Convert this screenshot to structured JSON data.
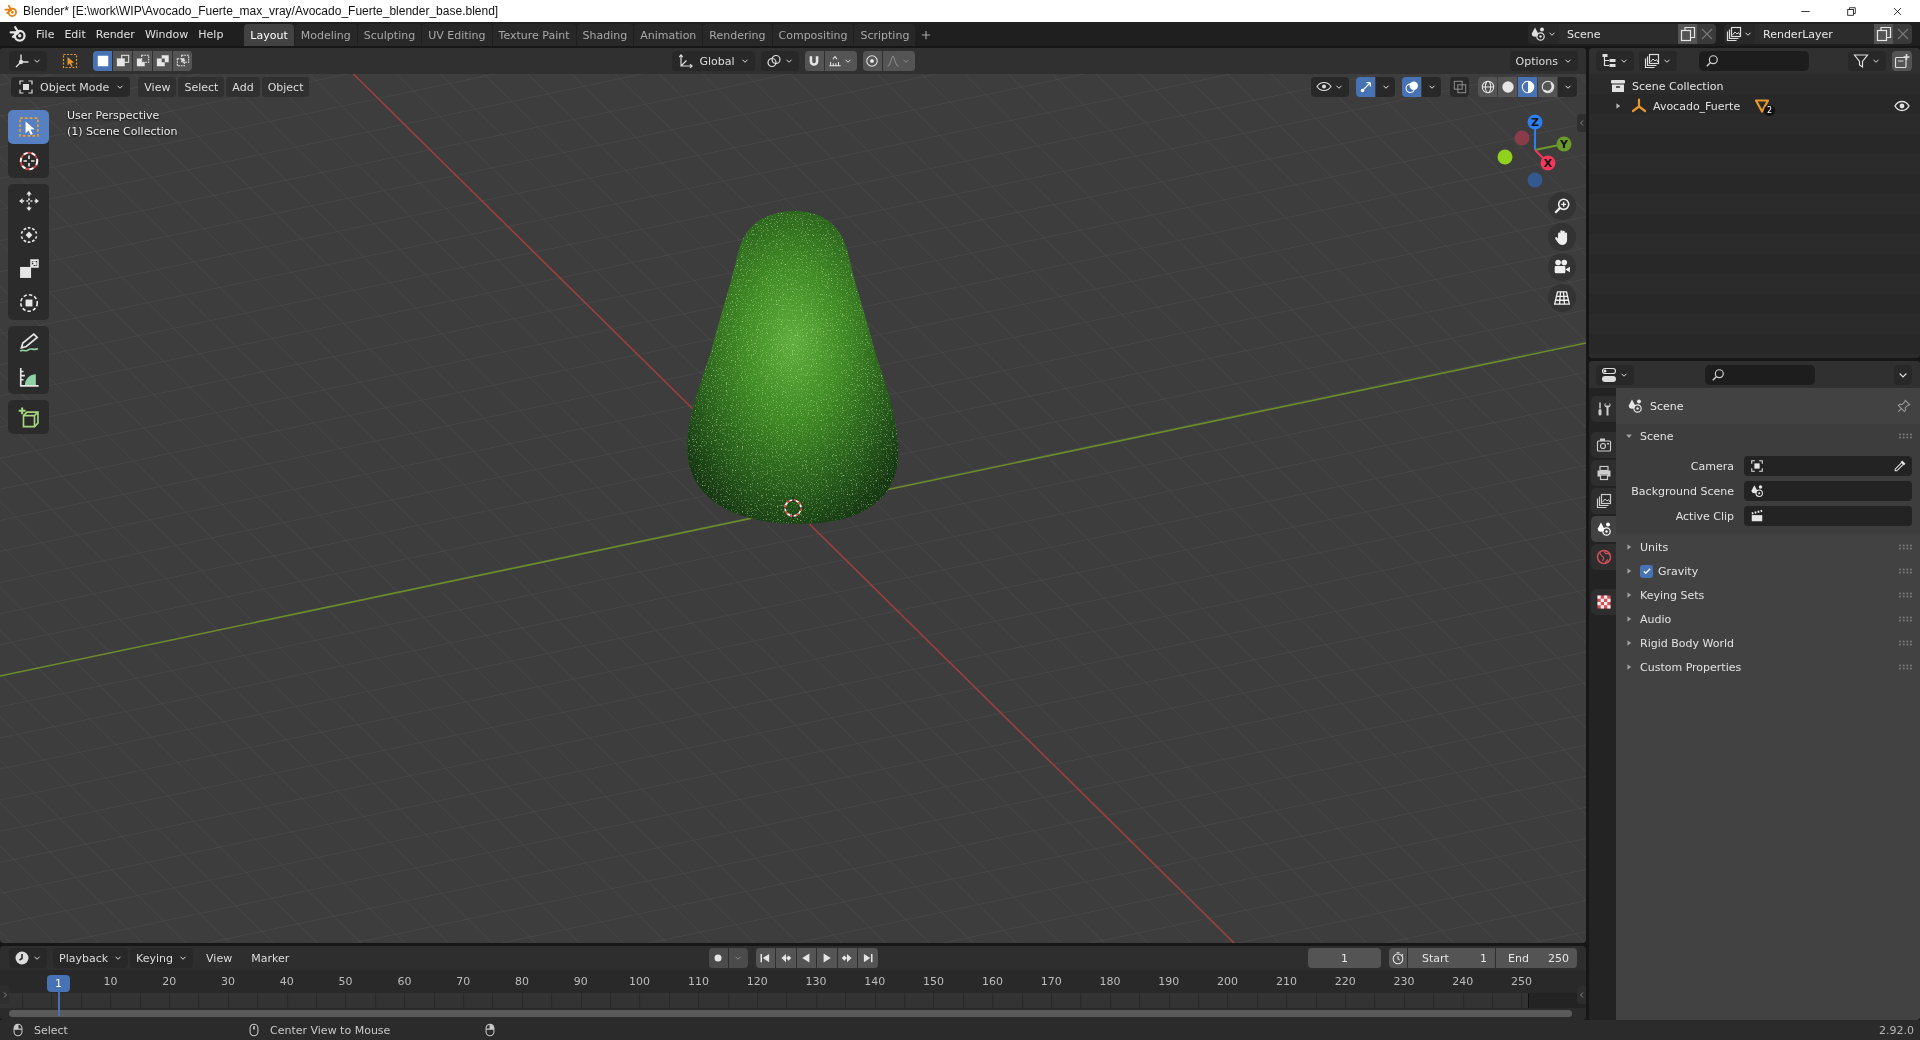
{
  "window": {
    "title": "Blender* [E:\\work\\WIP\\Avocado_Fuerte_max_vray/Avocado_Fuerte_blender_base.blend]"
  },
  "menu_bar": {
    "menus": [
      "File",
      "Edit",
      "Render",
      "Window",
      "Help"
    ]
  },
  "workspace_tabs": [
    {
      "label": "Layout",
      "selected": true
    },
    {
      "label": "Modeling",
      "selected": false
    },
    {
      "label": "Sculpting",
      "selected": false
    },
    {
      "label": "UV Editing",
      "selected": false
    },
    {
      "label": "Texture Paint",
      "selected": false
    },
    {
      "label": "Shading",
      "selected": false
    },
    {
      "label": "Animation",
      "selected": false
    },
    {
      "label": "Rendering",
      "selected": false
    },
    {
      "label": "Compositing",
      "selected": false
    },
    {
      "label": "Scripting",
      "selected": false
    }
  ],
  "scene_selector": {
    "value": "Scene"
  },
  "view_layer_selector": {
    "value": "RenderLayer"
  },
  "viewport": {
    "tool_header": {
      "selection_modes": [
        {
          "kind": "set",
          "selected": true
        },
        {
          "kind": "extend",
          "selected": false
        },
        {
          "kind": "subtract",
          "selected": false
        },
        {
          "kind": "difference",
          "selected": false
        },
        {
          "kind": "intersect",
          "selected": false
        }
      ],
      "orientation": "Global",
      "snap": {
        "on": false
      },
      "proportional_editing": {
        "on": false
      },
      "options": "Options"
    },
    "header": {
      "mode": "Object Mode",
      "menus": [
        "View",
        "Select",
        "Add",
        "Object"
      ],
      "gizmos": {
        "on": true
      },
      "overlays": {
        "on": true
      },
      "xray": {
        "on": false
      },
      "shading": [
        {
          "kind": "wireframe",
          "selected": false
        },
        {
          "kind": "solid",
          "selected": false
        },
        {
          "kind": "material",
          "selected": true
        },
        {
          "kind": "rendered",
          "selected": false
        }
      ]
    },
    "tool_groups": [
      {
        "tools": [
          {
            "kind": "select_box",
            "selected": true
          },
          {
            "kind": "cursor",
            "selected": false
          }
        ]
      },
      {
        "tools": [
          {
            "kind": "move",
            "selected": false
          },
          {
            "kind": "rotate",
            "selected": false
          },
          {
            "kind": "scale",
            "selected": false
          },
          {
            "kind": "transform",
            "selected": false
          }
        ]
      },
      {
        "tools": [
          {
            "kind": "annotate",
            "selected": false
          },
          {
            "kind": "measure",
            "selected": false
          }
        ]
      },
      {
        "tools": [
          {
            "kind": "add_cube",
            "selected": false
          }
        ]
      }
    ],
    "overlay_text": [
      "User Perspective",
      "(1) Scene Collection"
    ],
    "gizmo_axes": [
      {
        "label": "Z",
        "color": "#2f7ef0"
      },
      {
        "label": "Y",
        "color": "#6b9b2a"
      },
      {
        "label": "X",
        "color": "#f2385a"
      }
    ]
  },
  "timeline": {
    "menus": [
      {
        "label": "Playback",
        "dropdown": true
      },
      {
        "label": "Keying",
        "dropdown": true
      },
      {
        "label": "View",
        "dropdown": false
      },
      {
        "label": "Marker",
        "dropdown": false
      }
    ],
    "auto_keying": {
      "on": false
    },
    "current_frame": "1",
    "preview_range": {
      "on": false
    },
    "start": {
      "label": "Start",
      "value": "1"
    },
    "end": {
      "label": "End",
      "value": "250"
    },
    "playhead": "1",
    "ruler": [
      "10",
      "20",
      "30",
      "40",
      "50",
      "60",
      "70",
      "80",
      "90",
      "100",
      "110",
      "120",
      "130",
      "140",
      "150",
      "160",
      "170",
      "180",
      "190",
      "200",
      "210",
      "220",
      "230",
      "240",
      "250"
    ]
  },
  "status_bar": {
    "hints": [
      {
        "kind": "left_click",
        "label": "Select"
      },
      {
        "kind": "middle_click",
        "label": "Center View to Mouse"
      },
      {
        "kind": "right_click"
      }
    ],
    "version": "2.92.0"
  },
  "outliner": {
    "tree": [
      {
        "label": "Scene Collection",
        "kind": "collection",
        "children": [
          {
            "label": "Avocado_Fuerte",
            "kind": "empty",
            "expanded": false,
            "data_users": "2"
          }
        ]
      }
    ]
  },
  "properties": {
    "tab_groups": [
      {
        "tabs": [
          {
            "kind": "tool",
            "selected": false
          }
        ]
      },
      {
        "tabs": [
          {
            "kind": "render",
            "selected": false
          },
          {
            "kind": "output",
            "selected": false
          },
          {
            "kind": "view_layer",
            "selected": false
          },
          {
            "kind": "scene",
            "selected": true
          },
          {
            "kind": "world",
            "selected": false
          }
        ]
      },
      {
        "tabs": [
          {
            "kind": "texture",
            "selected": false
          }
        ]
      }
    ],
    "context": "Scene",
    "panels": [
      {
        "title": "Scene",
        "expanded": true,
        "fields": [
          {
            "label": "Camera",
            "kind": "object"
          },
          {
            "label": "Background Scene",
            "kind": "scene"
          },
          {
            "label": "Active Clip",
            "kind": "clip"
          }
        ]
      },
      {
        "title": "Units",
        "expanded": false
      },
      {
        "title": "Gravity",
        "expanded": false,
        "checked": true
      },
      {
        "title": "Keying Sets",
        "expanded": false
      },
      {
        "title": "Audio",
        "expanded": false
      },
      {
        "title": "Rigid Body World",
        "expanded": false
      },
      {
        "title": "Custom Properties",
        "expanded": false
      }
    ]
  }
}
